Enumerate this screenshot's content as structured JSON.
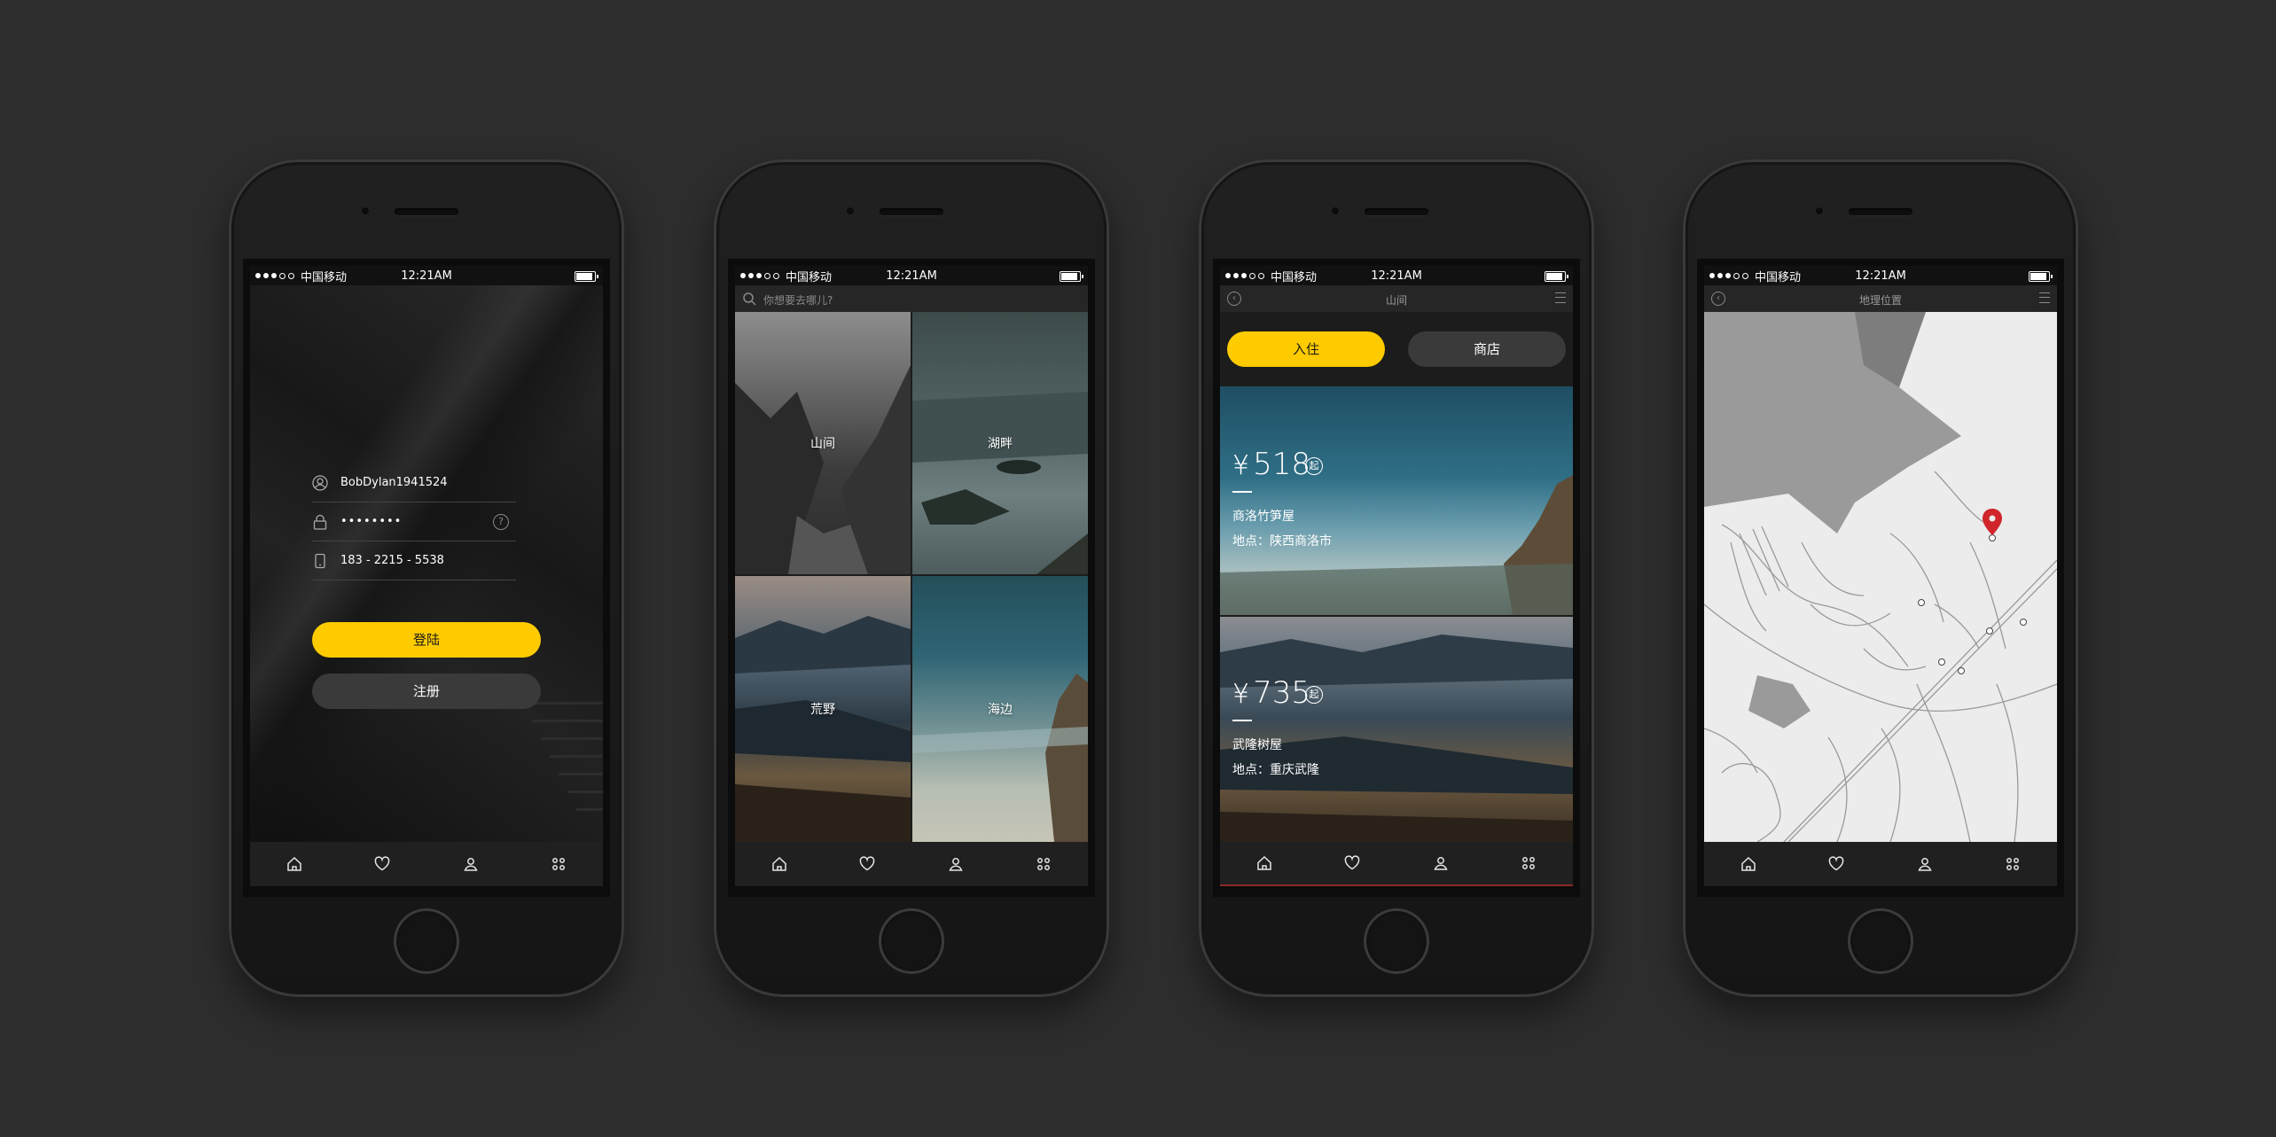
{
  "status": {
    "carrier": "中国移动",
    "time": "12:21AM"
  },
  "login": {
    "username": "BobDylan1941524",
    "password": "••••••••",
    "phone": "183 - 2215 - 5538",
    "help_icon": "?",
    "login_label": "登陆",
    "register_label": "注册"
  },
  "explore": {
    "search_placeholder": "你想要去哪儿?",
    "tiles": [
      "山间",
      "湖畔",
      "荒野",
      "海边"
    ]
  },
  "listing": {
    "title": "山间",
    "segments": [
      "入住",
      "商店"
    ],
    "cards": [
      {
        "currency": "¥",
        "price": "518",
        "suffix": "起",
        "name": "商洛竹笋屋",
        "place": "地点：陕西商洛市"
      },
      {
        "currency": "¥",
        "price": "735",
        "suffix": "起",
        "name": "武隆树屋",
        "place": "地点：重庆武隆"
      }
    ]
  },
  "map_screen": {
    "title": "地理位置"
  },
  "tabbar": [
    "home-icon",
    "heart-icon",
    "user-icon",
    "grid-icon"
  ],
  "colors": {
    "accent": "#fecb00",
    "background": "#2d2d2d",
    "marker": "#d0262b"
  }
}
